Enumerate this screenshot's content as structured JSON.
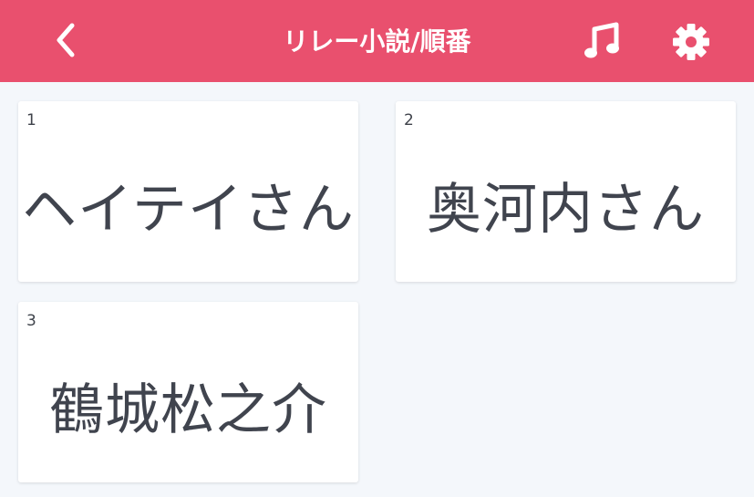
{
  "header": {
    "title": "リレー小説/順番",
    "background_color": "#e9506e",
    "back_icon": "chevron-left-icon",
    "music_icon": "music-note-icon",
    "settings_icon": "gear-icon"
  },
  "cards": [
    {
      "number": "1",
      "name": "ヘイテイさん"
    },
    {
      "number": "2",
      "name": "奥河内さん"
    },
    {
      "number": "3",
      "name": "鶴城松之介"
    }
  ]
}
